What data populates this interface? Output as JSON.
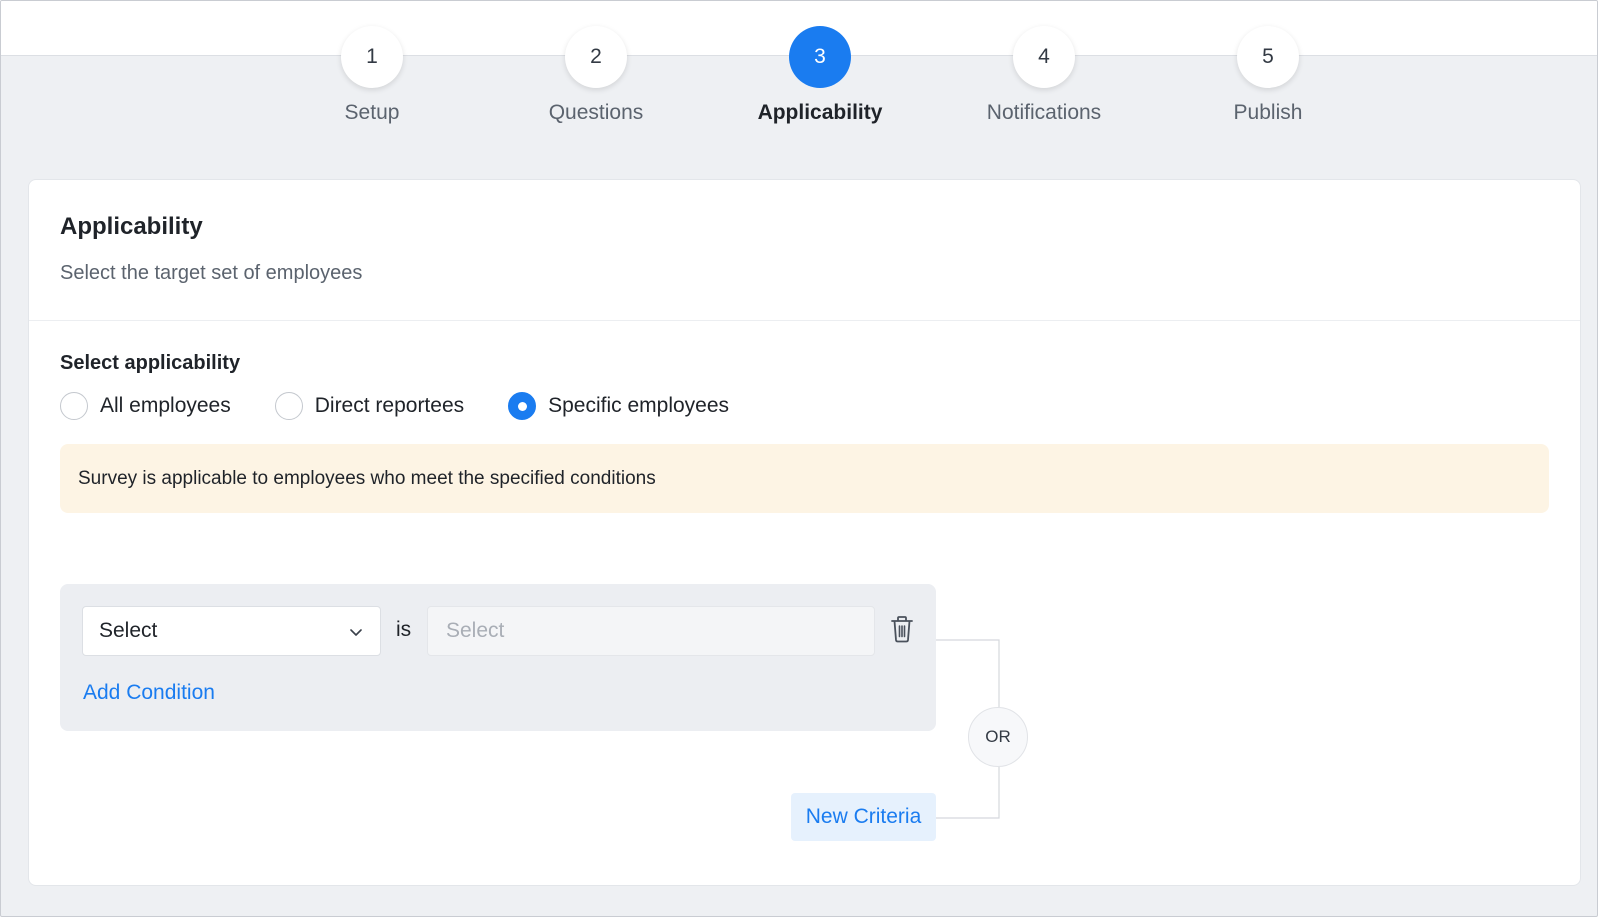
{
  "stepper": {
    "steps": [
      {
        "number": "1",
        "label": "Setup",
        "active": false
      },
      {
        "number": "2",
        "label": "Questions",
        "active": false
      },
      {
        "number": "3",
        "label": "Applicability",
        "active": true
      },
      {
        "number": "4",
        "label": "Notifications",
        "active": false
      },
      {
        "number": "5",
        "label": "Publish",
        "active": false
      }
    ]
  },
  "card": {
    "title": "Applicability",
    "subtitle": "Select the target set of employees"
  },
  "applicability": {
    "label": "Select applicability",
    "options": [
      {
        "label": "All employees",
        "checked": false
      },
      {
        "label": "Direct reportees",
        "checked": false
      },
      {
        "label": "Specific employees",
        "checked": true
      }
    ]
  },
  "notice": {
    "text": "Survey is applicable to employees who meet the specified conditions"
  },
  "criteria": {
    "field_dropdown": {
      "value": "Select"
    },
    "operator": "is",
    "value_field": {
      "placeholder": "Select"
    },
    "add_condition": "Add Condition",
    "or_label": "OR",
    "new_criteria": "New Criteria"
  },
  "colors": {
    "accent": "#1a7cf0",
    "notice_bg": "#fdf4e4",
    "page_bg": "#eef0f3"
  },
  "icons": [
    "chevron-down-icon",
    "trash-icon"
  ]
}
